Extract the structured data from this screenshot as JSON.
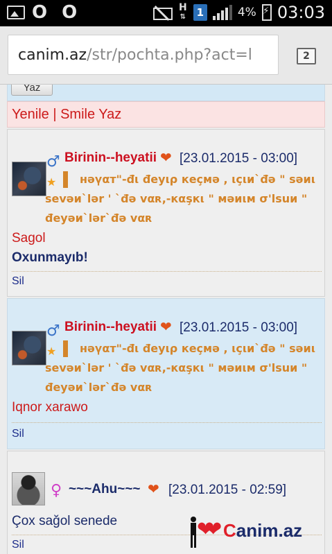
{
  "status_bar": {
    "left_icons": [
      "image-icon",
      "circle-o-icon",
      "circle-o-icon"
    ],
    "oo_text": "O O",
    "network_label": "H",
    "sim_label": "1",
    "battery": "4%",
    "time": "03:03"
  },
  "url_bar": {
    "host": "canim.az",
    "path": "/str/pochta.php?act=l",
    "tab_count": "2"
  },
  "top": {
    "write_button": "Yaz",
    "refresh_link": "Yenile",
    "separator": "|",
    "smile_link": "Smile Yaz"
  },
  "messages": [
    {
      "username": "Birinin--heyatii",
      "gender": "male",
      "date": "[23.01.2015 - 03:00]",
      "status_line1": "нәүαт\"-đι đeyιρ кeçмә , ιçιи`đә \" ѕәиι",
      "status_line2": "ѕevәи`lәr ' `đә vαʀ,-кαşкι \" мәиιм σ'lѕuи \"",
      "status_line3": "đeyәи`lәr`đә vαʀ",
      "text1": "Sagol",
      "text2": "Oxunmayıb!",
      "delete": "Sil"
    },
    {
      "username": "Birinin--heyatii",
      "gender": "male",
      "date": "[23.01.2015 - 03:00]",
      "status_line1": "нәүαт\"-đι đeyιρ кeçмә , ιçιи`đә \" ѕәиι",
      "status_line2": "ѕevәи`lәr ' `đә vαʀ,-кαşкι \" мәиιм σ'lѕuи \"",
      "status_line3": "đeyәи`lәr`đә vαʀ",
      "text1": "Iqnor xarawo",
      "delete": "Sil"
    },
    {
      "username": "~~~Ahu~~~",
      "gender": "female",
      "date": "[23.01.2015 - 02:59]",
      "text1": "Çox sağol senede",
      "delete": "Sil"
    }
  ],
  "watermark": {
    "brand_c": "C",
    "brand_rest": "anim.az"
  }
}
